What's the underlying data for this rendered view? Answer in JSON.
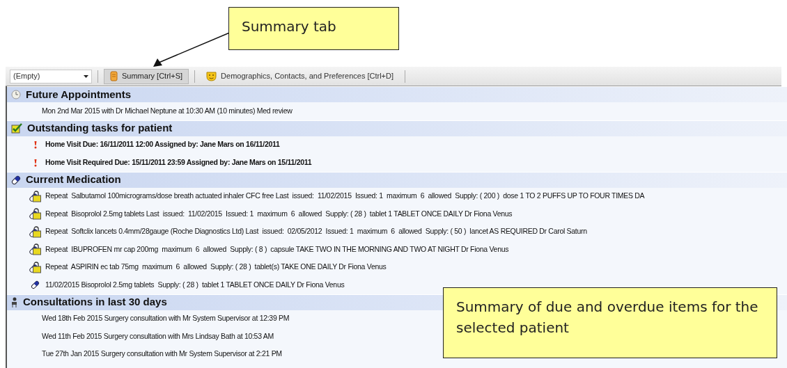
{
  "callouts": [
    {
      "text": "Summary tab",
      "kind": "top"
    },
    {
      "text": "Summary of due and overdue items for the selected patient",
      "kind": "bottom"
    }
  ],
  "toolbar": {
    "dropdown": {
      "value": "(Empty)"
    },
    "tabs": [
      {
        "label": "Summary [Ctrl+S]",
        "selected": true,
        "kind": "summary"
      },
      {
        "label": "Demographics, Contacts, and Preferences [Ctrl+D]",
        "selected": false,
        "kind": "demographics"
      }
    ]
  },
  "sections": [
    {
      "title": "Future Appointments",
      "kind": "clock",
      "items": [
        {
          "text": "Mon 2nd Mar 2015 with Dr Michael Neptune at 10:30 AM (10 minutes) Med review",
          "kind": "plain"
        }
      ]
    },
    {
      "title": "Outstanding tasks for patient",
      "kind": "task",
      "items": [
        {
          "text": "Home Visit Due: 16/11/2011 12:00 Assigned by: Jane Mars on 16/11/2011",
          "kind": "task"
        },
        {
          "text": "Home Visit Required Due: 15/11/2011 23:59 Assigned by: Jane Mars on 15/11/2011",
          "kind": "task"
        }
      ]
    },
    {
      "title": "Current Medication",
      "kind": "pill",
      "items": [
        {
          "text": "Repeat  Salbutamol 100micrograms/dose breath actuated inhaler CFC free Last  issued:  11/02/2015  Issued: 1  maximum  6  allowed  Supply: ( 200 )  dose 1 TO 2 PUFFS UP TO FOUR TIMES DA",
          "kind": "repeat"
        },
        {
          "text": "Repeat  Bisoprolol 2.5mg tablets Last  issued:  11/02/2015  Issued: 1  maximum  6  allowed  Supply: ( 28 )  tablet 1 TABLET ONCE DAILY Dr Fiona Venus",
          "kind": "repeat"
        },
        {
          "text": "Repeat  Softclix lancets 0.4mm/28gauge (Roche Diagnostics Ltd) Last  issued:  02/05/2012  Issued: 1  maximum  6  allowed  Supply: ( 50 )  lancet AS REQUIRED Dr Carol Saturn",
          "kind": "repeat"
        },
        {
          "text": "Repeat  IBUPROFEN mr cap 200mg  maximum  6  allowed  Supply: ( 8 )  capsule TAKE TWO IN THE MORNING AND TWO AT NIGHT Dr Fiona Venus",
          "kind": "repeat"
        },
        {
          "text": "Repeat  ASPIRIN ec tab 75mg  maximum  6  allowed  Supply: ( 28 )  tablet(s) TAKE ONE DAILY Dr Fiona Venus",
          "kind": "repeat"
        },
        {
          "text": "11/02/2015 Bisoprolol 2.5mg tablets  Supply: ( 28 )  tablet 1 TABLET ONCE DAILY Dr Fiona Venus",
          "kind": "acute"
        }
      ]
    },
    {
      "title": "Consultations in last 30 days",
      "kind": "person",
      "items": [
        {
          "text": "Wed 18th Feb 2015 Surgery consultation with Mr System Supervisor at 12:39 PM",
          "kind": "plain"
        },
        {
          "text": "Wed 11th Feb 2015 Surgery consultation with Mrs Lindsay Bath at 10:53 AM",
          "kind": "plain"
        },
        {
          "text": "Tue 27th Jan 2015 Surgery consultation with Mr System Supervisor at 2:21 PM",
          "kind": "plain"
        }
      ]
    }
  ]
}
